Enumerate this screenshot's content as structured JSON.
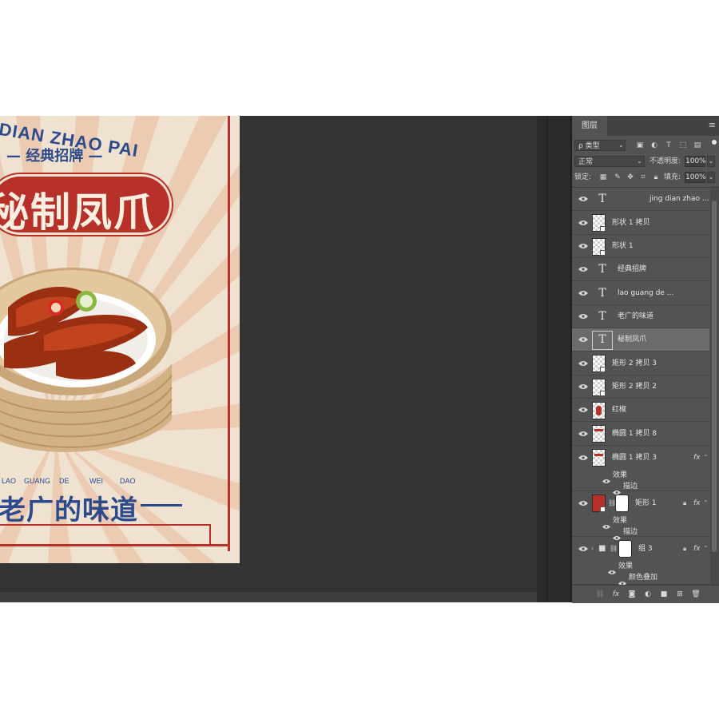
{
  "poster": {
    "en_title": "G DIAN ZHAO PAI",
    "sub_title": "— 经典招牌 —",
    "main_title": "秘制凤爪",
    "pinyin": [
      "LAO",
      "GUANG",
      "DE",
      "WEI",
      "DAO"
    ],
    "bottom_title": "老广的味道"
  },
  "panel": {
    "tab_label": "图层",
    "filter_label": "ρ 类型",
    "blend_mode": "正常",
    "opacity_label": "不透明度:",
    "opacity_value": "100%",
    "lock_label": "锁定:",
    "fill_label": "填充:",
    "fill_value": "100%"
  },
  "layers": [
    {
      "name": "jing dian zhao ...",
      "kind": "text"
    },
    {
      "name": "形状 1 拷贝",
      "kind": "shape"
    },
    {
      "name": "形状 1",
      "kind": "shape"
    },
    {
      "name": "经典招牌",
      "kind": "text"
    },
    {
      "name": "lao   guang   de   ...",
      "kind": "text"
    },
    {
      "name": "老广的味道",
      "kind": "text"
    },
    {
      "name": "秘制凤爪",
      "kind": "text",
      "selected": true
    },
    {
      "name": "矩形 2 拷贝 3",
      "kind": "shape"
    },
    {
      "name": "矩形 2 拷贝 2",
      "kind": "shape"
    },
    {
      "name": "红椒",
      "kind": "image"
    },
    {
      "name": "椭圆 1 拷贝 8",
      "kind": "shape"
    },
    {
      "name": "椭圆 1 拷贝 3",
      "kind": "shape",
      "fx": "fx",
      "effects_label": "效果",
      "effect": "描边"
    },
    {
      "name": "矩形 1",
      "kind": "masked",
      "fx": "fx",
      "effects_label": "效果",
      "effect": "描边"
    },
    {
      "name": "组 3",
      "kind": "group",
      "fx": "fx",
      "effects_label": "效果",
      "effect": "颜色叠加"
    }
  ],
  "footer_icons": [
    "link-layers-icon",
    "fx-icon",
    "add-mask-icon",
    "adjustment-layer-icon",
    "new-group-icon",
    "new-layer-icon",
    "trash-icon"
  ],
  "footer_fx": "fx",
  "colors": {
    "poster_red": "#b8302a",
    "poster_blue": "#2d4a8c",
    "poster_bg": "#efe2d0",
    "panel_bg": "#535353"
  }
}
